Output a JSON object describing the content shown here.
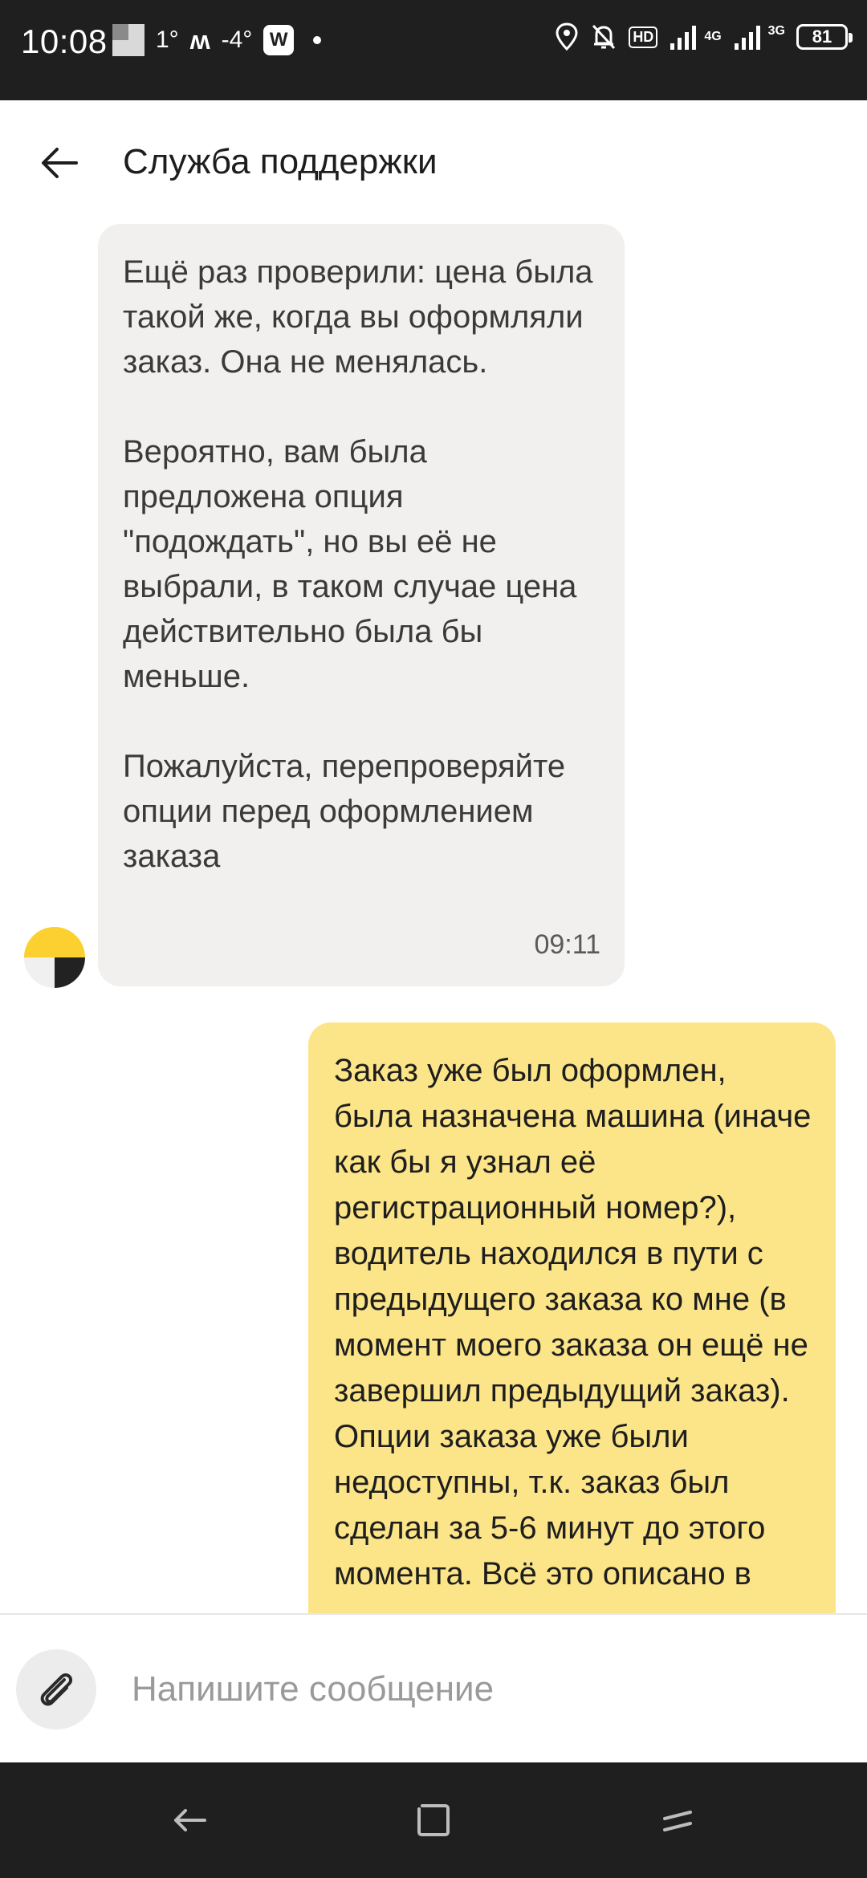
{
  "status_bar": {
    "time": "10:08",
    "temp1": "1°",
    "temp2": "-4°",
    "box_icon": "W",
    "hd_label": "HD",
    "net1": "4G",
    "net2": "3G",
    "battery": "81"
  },
  "header": {
    "title": "Служба поддержки"
  },
  "messages": {
    "incoming": {
      "paragraphs": [
        "Ещё раз проверили: цена была такой же, когда вы оформляли заказ. Она не менялась.",
        "Вероятно, вам была предложена опция \"подождать\", но вы её не выбрали, в таком случае цена действительно была бы меньше.",
        "Пожалуйста, перепроверяйте опции перед оформлением заказа"
      ],
      "time": "09:11"
    },
    "outgoing": {
      "text": "Заказ уже был оформлен, была назначена машина (иначе как бы я узнал её регистрационный номер?), водитель находился в пути с предыдущего заказа ко мне (в момент моего заказа он ещё не завершил предыдущий заказ). Опции заказа уже были недоступны, т.к. заказ был сделан за 5-6 минут до этого момента. Всё это описано в"
    }
  },
  "composer": {
    "placeholder": "Напишите сообщение"
  },
  "icons": {
    "back": "arrow-left-icon",
    "attach": "paperclip-icon",
    "avatar": "support-avatar",
    "nav_back": "nav-back-icon",
    "nav_home": "nav-home-icon",
    "nav_recents": "nav-recents-icon"
  },
  "colors": {
    "incoming_bubble": "#f1f0ee",
    "outgoing_bubble": "#fce588",
    "avatar_yellow": "#fcd12f"
  }
}
